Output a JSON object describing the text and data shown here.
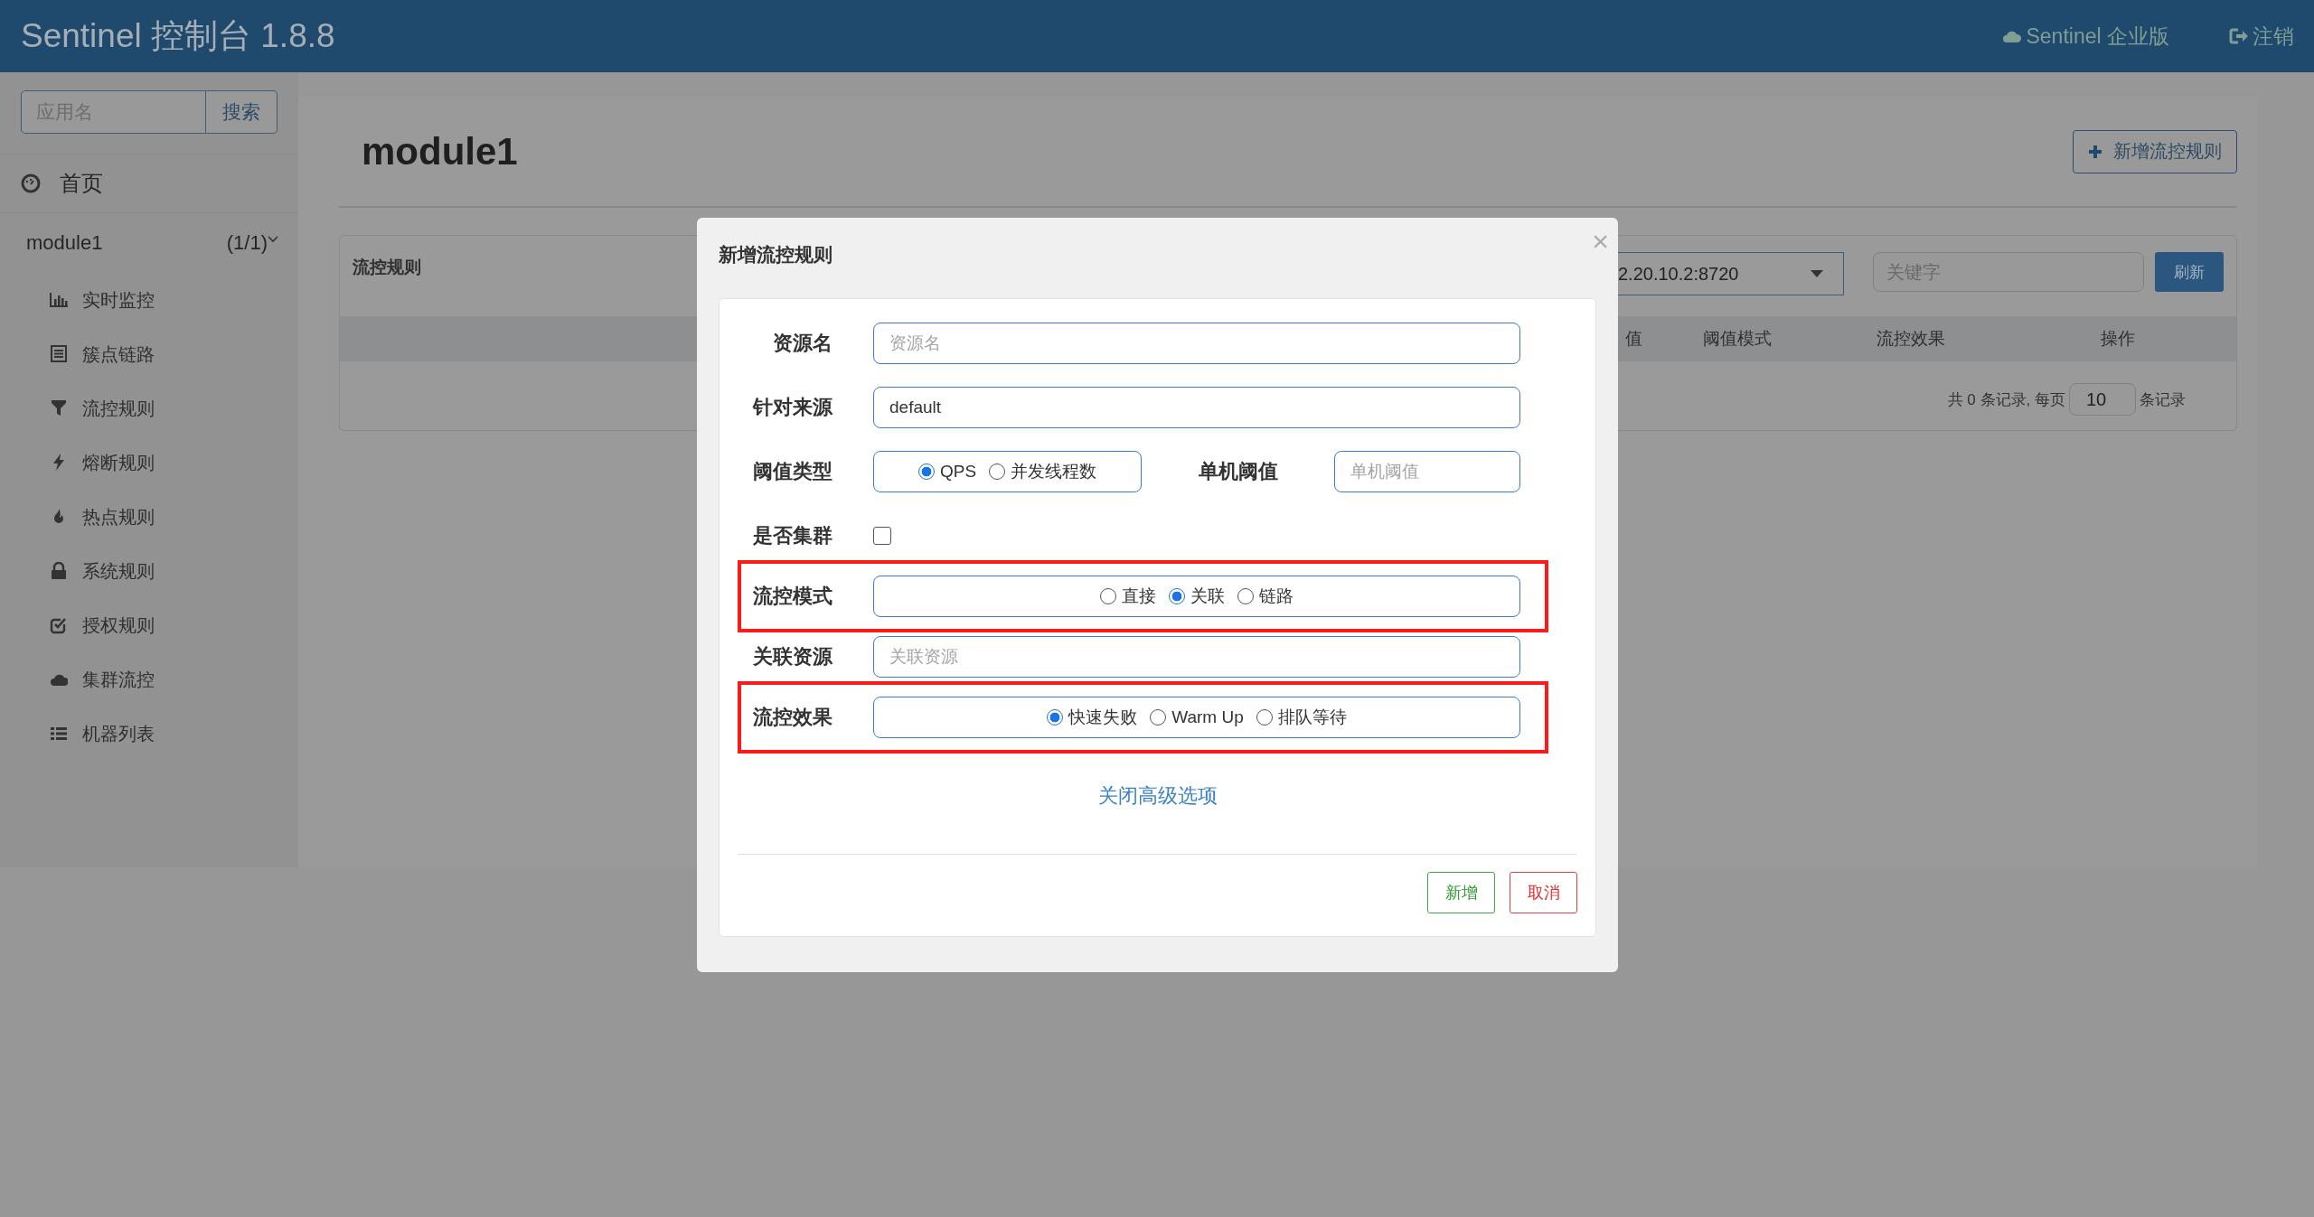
{
  "header": {
    "title": "Sentinel 控制台 1.8.8",
    "links": [
      {
        "kind": "cloud",
        "label": "Sentinel 企业版"
      },
      {
        "kind": "logout",
        "label": "注销"
      }
    ]
  },
  "sidebar": {
    "search": {
      "placeholder": "应用名",
      "button": "搜索"
    },
    "home": "首页",
    "app": {
      "name": "module1",
      "count": "(1/1)",
      "expanded": true
    },
    "items": [
      {
        "label": "实时监控"
      },
      {
        "label": "簇点链路"
      },
      {
        "label": "流控规则"
      },
      {
        "label": "熔断规则"
      },
      {
        "label": "热点规则"
      },
      {
        "label": "系统规则"
      },
      {
        "label": "授权规则"
      },
      {
        "label": "集群流控"
      },
      {
        "label": "机器列表"
      }
    ]
  },
  "page": {
    "title": "module1",
    "add_button": "新增流控规则",
    "card": {
      "title": "流控规则",
      "machine": "2.20.10.2:8720",
      "search_placeholder": "关键字",
      "refresh": "刷新",
      "columns": [
        "值",
        "阈值模式",
        "流控效果",
        "操作"
      ],
      "pagination": {
        "total": "共 0 条记录, 每页",
        "page_size": "10",
        "suffix": "条记录"
      }
    }
  },
  "modal": {
    "title": "新增流控规则",
    "close": "×",
    "fields": [
      {
        "kind": "input",
        "label": "资源名",
        "placeholder": "资源名",
        "highlighted": false
      },
      {
        "kind": "input",
        "label": "针对来源",
        "value": "default",
        "highlighted": false
      },
      {
        "kind": "threshold",
        "label": "阈值类型",
        "options": [
          {
            "label": "QPS",
            "selected": true
          },
          {
            "label": "并发线程数",
            "selected": false
          }
        ],
        "second_label": "单机阈值",
        "placeholder": "单机阈值",
        "highlighted": false
      },
      {
        "kind": "checkbox",
        "label": "是否集群",
        "checked": false,
        "highlighted": false
      },
      {
        "kind": "radio",
        "label": "流控模式",
        "options": [
          {
            "label": "直接",
            "selected": false
          },
          {
            "label": "关联",
            "selected": true
          },
          {
            "label": "链路",
            "selected": false
          }
        ],
        "highlighted": true
      },
      {
        "kind": "input",
        "label": "关联资源",
        "placeholder": "关联资源",
        "highlighted": false
      },
      {
        "kind": "radio",
        "label": "流控效果",
        "options": [
          {
            "label": "快速失败",
            "selected": true
          },
          {
            "label": "Warm Up",
            "selected": false
          },
          {
            "label": "排队等待",
            "selected": false
          }
        ],
        "highlighted": true
      }
    ],
    "toggle_link": "关闭高级选项",
    "buttons": [
      {
        "kind": "ok",
        "label": "新增"
      },
      {
        "kind": "cancel",
        "label": "取消"
      }
    ]
  }
}
